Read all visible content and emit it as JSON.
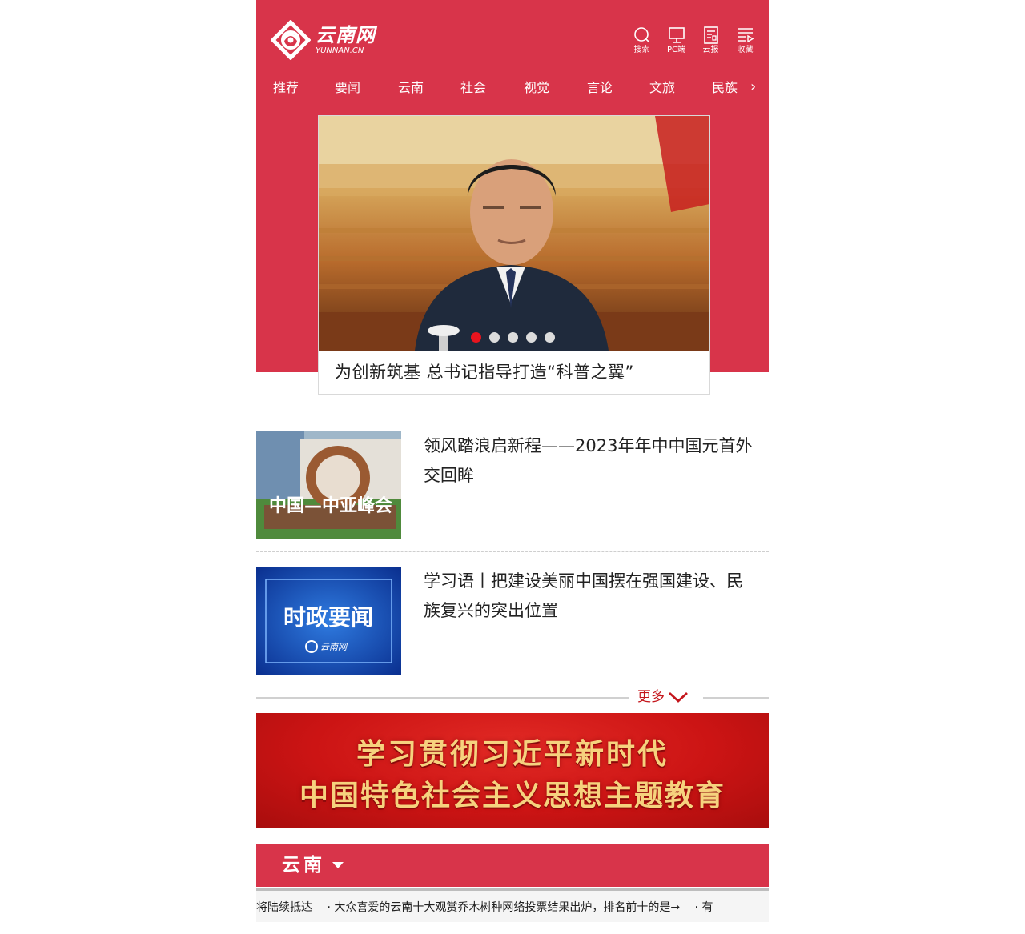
{
  "header": {
    "logo_cn": "云南网",
    "logo_en": "YUNNAN.CN",
    "icons": [
      {
        "name": "search-icon",
        "label": "搜索"
      },
      {
        "name": "pc-icon",
        "label": "PC端"
      },
      {
        "name": "newspaper-icon",
        "label": "云报"
      },
      {
        "name": "bookmark-icon",
        "label": "收藏"
      }
    ]
  },
  "nav": {
    "items": [
      "推荐",
      "要闻",
      "云南",
      "社会",
      "视觉",
      "言论",
      "文旅",
      "民族"
    ],
    "more_arrow": "›"
  },
  "hero": {
    "caption": "为创新筑基 总书记指导打造“科普之翼”",
    "slide_count": 5,
    "active_slide": 1
  },
  "news": [
    {
      "title": "领风踏浪启新程——2023年年中中国元首外交回眸",
      "thumb_text": "中国—中亚峰会"
    },
    {
      "title": "学习语丨把建设美丽中国摆在强国建设、民族复兴的突出位置",
      "thumb_text": "时政要闻",
      "thumb_logo": "云南网"
    }
  ],
  "more": {
    "label": "更多"
  },
  "banner": {
    "line1": "学习贯彻习近平新时代",
    "line2": "中国特色社会主义思想主题教育"
  },
  "section": {
    "title": "云南"
  },
  "ticker": {
    "items": [
      "将陆续抵达",
      "· 大众喜爱的云南十大观赏乔木树种网络投票结果出炉，排名前十的是→",
      "· 有"
    ]
  },
  "colors": {
    "brand_red": "#d8344a",
    "accent_red": "#c4161c",
    "active_dot": "#e8141e",
    "banner_gold": "#f6d27e"
  }
}
